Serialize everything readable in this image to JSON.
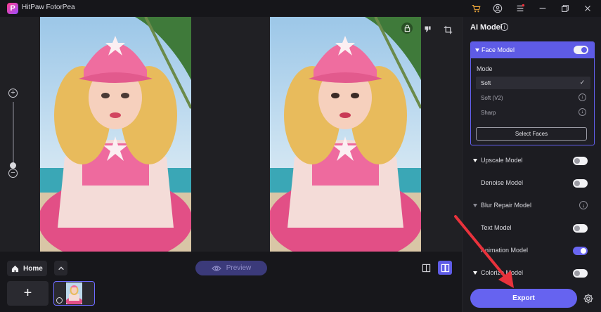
{
  "app": {
    "title": "HitPaw FotorPea",
    "logo_letter": "P"
  },
  "titlebar_icons": [
    "cart-icon",
    "account-icon",
    "menu-icon",
    "minimize-icon",
    "restore-icon",
    "close-icon"
  ],
  "canvas": {
    "zoom_in": "+",
    "zoom_out": "−"
  },
  "bottom": {
    "home_label": "Home",
    "add_label": "+",
    "preview_label": "Preview"
  },
  "panel": {
    "title": "AI Model",
    "info": "i",
    "face_model": {
      "label": "Face Model",
      "enabled": true,
      "mode_label": "Mode",
      "modes": [
        {
          "label": "Soft",
          "selected": true,
          "state": "✓"
        },
        {
          "label": "Soft (V2)",
          "selected": false,
          "state": "↓"
        },
        {
          "label": "Sharp",
          "selected": false,
          "state": "↓"
        }
      ],
      "select_faces": "Select Faces"
    },
    "models": [
      {
        "label": "Upscale Model",
        "caret": true,
        "control": "toggle",
        "on": false
      },
      {
        "label": "Denoise Model",
        "caret": false,
        "control": "toggle",
        "on": false
      },
      {
        "label": "Blur Repair Model",
        "caret": true,
        "control": "download",
        "on": false
      },
      {
        "label": "Text Model",
        "caret": false,
        "control": "toggle",
        "on": false
      },
      {
        "label": "Animation Model",
        "caret": false,
        "control": "toggle",
        "on": true
      },
      {
        "label": "Colorize Model",
        "caret": true,
        "control": "toggle",
        "on": false
      }
    ],
    "export_label": "Export"
  },
  "colors": {
    "accent": "#6663f0",
    "annotation_arrow": "#e8323c",
    "panel_bg": "#1c1c21"
  }
}
